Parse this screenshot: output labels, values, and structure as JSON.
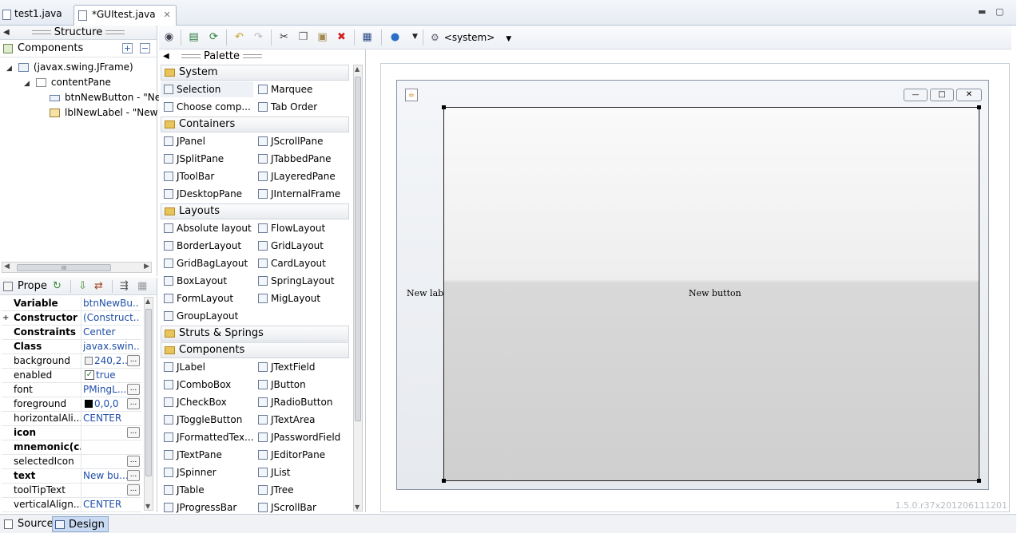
{
  "editor_tabs": [
    {
      "label": "test1.java",
      "active": false
    },
    {
      "label": "*GUItest.java",
      "active": true
    }
  ],
  "structure": {
    "title": "Structure",
    "components_label": "Components",
    "tree": [
      {
        "label": "(javax.swing.JFrame)",
        "level": 0
      },
      {
        "label": "contentPane",
        "level": 1
      },
      {
        "label": "btnNewButton - \"Ne",
        "level": 2
      },
      {
        "label": "lblNewLabel - \"New",
        "level": 2
      }
    ],
    "scroll_mark": "III"
  },
  "properties": {
    "title": "Prope",
    "rows": [
      {
        "name": "Variable",
        "value": "btnNewBu...",
        "bold": true,
        "dots": false
      },
      {
        "name": "Constructor",
        "value": "(Construct...",
        "bold": true,
        "dots": false,
        "expand": "+"
      },
      {
        "name": "Constraints",
        "value": "Center",
        "bold": true,
        "dots": false
      },
      {
        "name": "Class",
        "value": "javax.swin...",
        "bold": true,
        "dots": false
      },
      {
        "name": "background",
        "value": "240,2...",
        "bold": false,
        "dots": true,
        "swatch": "#f0f0f0"
      },
      {
        "name": "enabled",
        "value": "true",
        "bold": false,
        "dots": false,
        "check": true
      },
      {
        "name": "font",
        "value": "PMingL...",
        "bold": false,
        "dots": true
      },
      {
        "name": "foreground",
        "value": "0,0,0",
        "bold": false,
        "dots": true,
        "swatch": "#000000"
      },
      {
        "name": "horizontalAli...",
        "value": "CENTER",
        "bold": false,
        "dots": false
      },
      {
        "name": "icon",
        "value": "",
        "bold": true,
        "dots": true
      },
      {
        "name": "mnemonic(c...",
        "value": "",
        "bold": true,
        "dots": false
      },
      {
        "name": "selectedIcon",
        "value": "",
        "bold": false,
        "dots": true
      },
      {
        "name": "text",
        "value": "New bu...",
        "bold": true,
        "dots": true
      },
      {
        "name": "toolTipText",
        "value": "",
        "bold": false,
        "dots": true
      },
      {
        "name": "verticalAlign...",
        "value": "CENTER",
        "bold": false,
        "dots": false
      }
    ],
    "dots_label": "..."
  },
  "toolbar": {
    "system_label": "<system>"
  },
  "palette": {
    "title": "Palette",
    "categories": [
      {
        "name": "System",
        "items": [
          "Selection",
          "Marquee",
          "Choose comp...",
          "Tab Order"
        ]
      },
      {
        "name": "Containers",
        "items": [
          "JPanel",
          "JScrollPane",
          "JSplitPane",
          "JTabbedPane",
          "JToolBar",
          "JLayeredPane",
          "JDesktopPane",
          "JInternalFrame"
        ]
      },
      {
        "name": "Layouts",
        "items": [
          "Absolute layout",
          "FlowLayout",
          "BorderLayout",
          "GridLayout",
          "GridBagLayout",
          "CardLayout",
          "BoxLayout",
          "SpringLayout",
          "FormLayout",
          "MigLayout",
          "GroupLayout"
        ]
      },
      {
        "name": "Struts & Springs",
        "items": []
      },
      {
        "name": "Components",
        "items": [
          "JLabel",
          "JTextField",
          "JComboBox",
          "JButton",
          "JCheckBox",
          "JRadioButton",
          "JToggleButton",
          "JTextArea",
          "JFormattedTex...",
          "JPasswordField",
          "JTextPane",
          "JEditorPane",
          "JSpinner",
          "JList",
          "JTable",
          "JTree",
          "JProgressBar",
          "JScrollBar"
        ]
      }
    ]
  },
  "design": {
    "label_text": "New label",
    "button_text": "New button",
    "version": "1.5.0.r37x201206111201",
    "frame_buttons": [
      "—",
      "□",
      "✕"
    ]
  },
  "bottom_tabs": [
    {
      "label": "Source",
      "active": false
    },
    {
      "label": "Design",
      "active": true
    }
  ]
}
